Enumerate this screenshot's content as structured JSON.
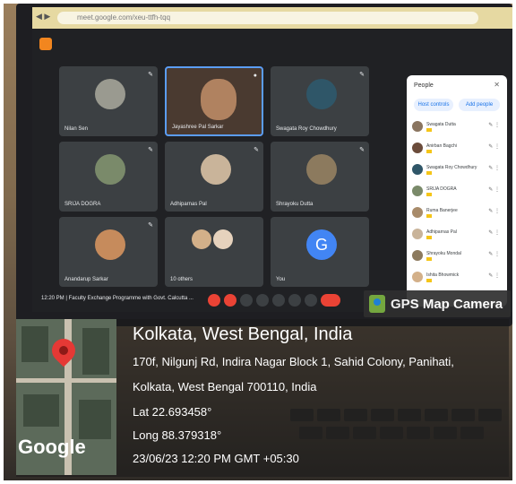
{
  "browser": {
    "url": "meet.google.com/xeu-ttfh-tqq"
  },
  "meeting": {
    "time_and_title": "12:20 PM | Faculty Exchange Programme with Govt. Calcutta ...",
    "tiles": [
      {
        "name": "Nilan Sen"
      },
      {
        "name": "Jayashree Pal Sarkar"
      },
      {
        "name": "Swagata Roy Chowdhury"
      },
      {
        "name": "SRIJA DOGRA"
      },
      {
        "name": "Adhiparnas Pal"
      },
      {
        "name": "Shrayoku Dutta"
      },
      {
        "name": "Anandarup Sarkar"
      },
      {
        "name": "10 others"
      },
      {
        "name": "You",
        "initial": "G"
      }
    ]
  },
  "people_panel": {
    "title": "People",
    "add_button": "Add people",
    "host_button": "Host controls",
    "participants": [
      {
        "name": "Swagata Dutta"
      },
      {
        "name": "Anirban Bagchi"
      },
      {
        "name": "Swagata Roy Chowdhury"
      },
      {
        "name": "SRIJA DOGRA"
      },
      {
        "name": "Ruma Banerjee"
      },
      {
        "name": "Adhiparnas Pal"
      },
      {
        "name": "Shrayoku Mondal"
      },
      {
        "name": "Ishita Bhowmick"
      }
    ]
  },
  "gps_camera": {
    "label": "GPS Map Camera",
    "city": "Kolkata, West Bengal, India",
    "address_line1": "170f, Nilgunj Rd, Indira Nagar Block 1, Sahid Colony, Panihati,",
    "address_line2": "Kolkata, West Bengal 700110, India",
    "latitude": "Lat 22.693458°",
    "longitude": "Long 88.379318°",
    "datetime": "23/06/23 12:20 PM GMT +05:30",
    "map_brand": "Google",
    "pin_color": "#e53935"
  }
}
